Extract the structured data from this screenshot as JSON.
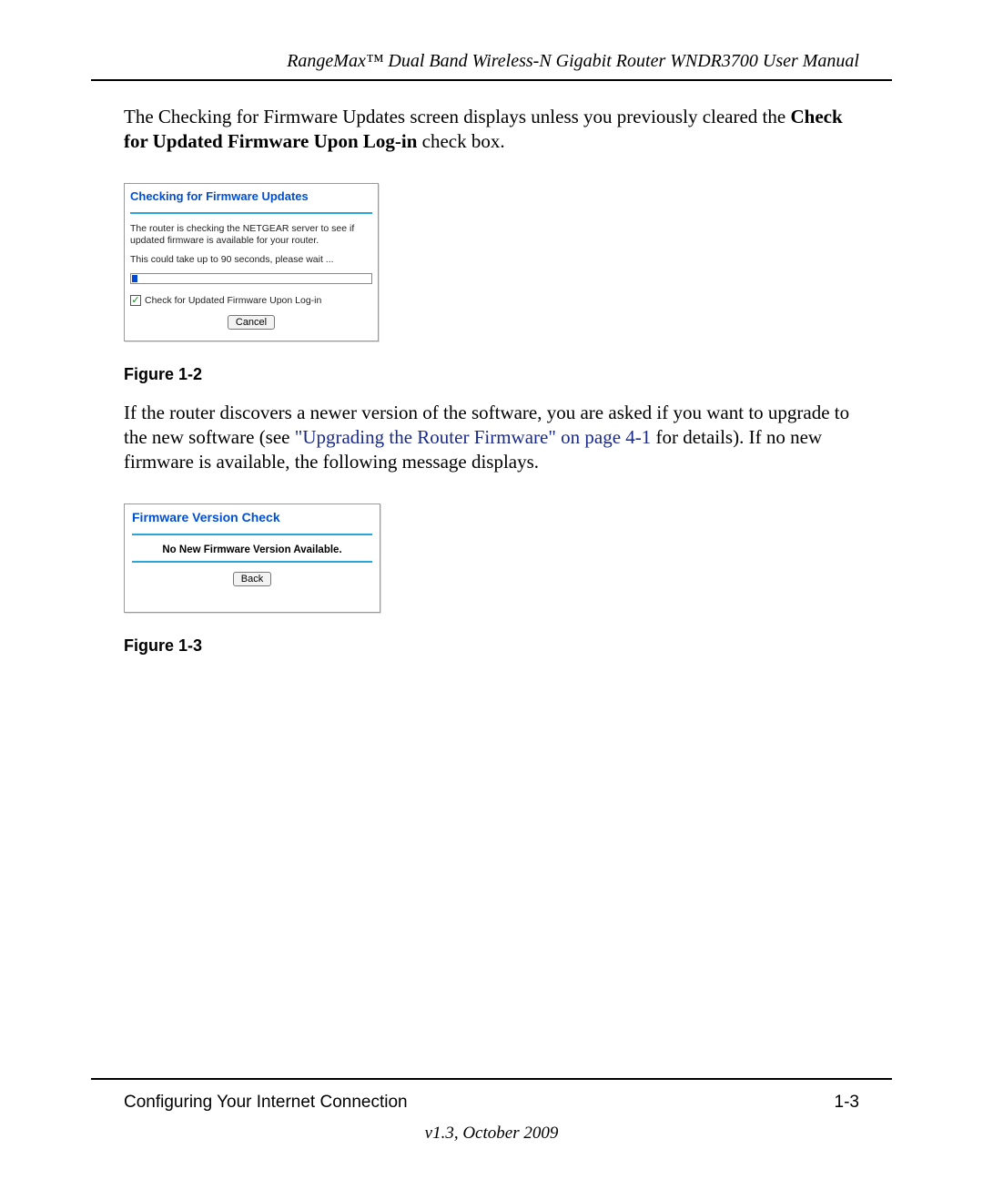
{
  "header": {
    "title": "RangeMax™ Dual Band Wireless-N Gigabit Router WNDR3700 User Manual"
  },
  "paragraphs": {
    "p1_a": "The Checking for Firmware Updates screen displays unless you previously cleared the ",
    "p1_b": "Check for Updated Firmware Upon Log-in",
    "p1_c": " check box.",
    "p2_a": "If the router discovers a newer version of the software, you are asked if you want to upgrade to the new software (see ",
    "p2_link": "\"Upgrading the Router Firmware\" on page 4-1",
    "p2_b": " for details). If no new firmware is available, the following message displays."
  },
  "figure1": {
    "caption": "Figure 1-2",
    "panel_title": "Checking for Firmware Updates",
    "line1": "The router is checking the NETGEAR server to see if updated firmware is available for your router.",
    "line2": "This could take up to 90 seconds, please wait ...",
    "checkbox_label": "Check for Updated Firmware Upon Log-in",
    "cancel": "Cancel",
    "checked": true
  },
  "figure2": {
    "caption": "Figure 1-3",
    "panel_title": "Firmware Version Check",
    "message": "No New Firmware Version Available.",
    "back": "Back"
  },
  "footer": {
    "left": "Configuring Your Internet Connection",
    "right": "1-3",
    "version": "v1.3, October 2009"
  }
}
